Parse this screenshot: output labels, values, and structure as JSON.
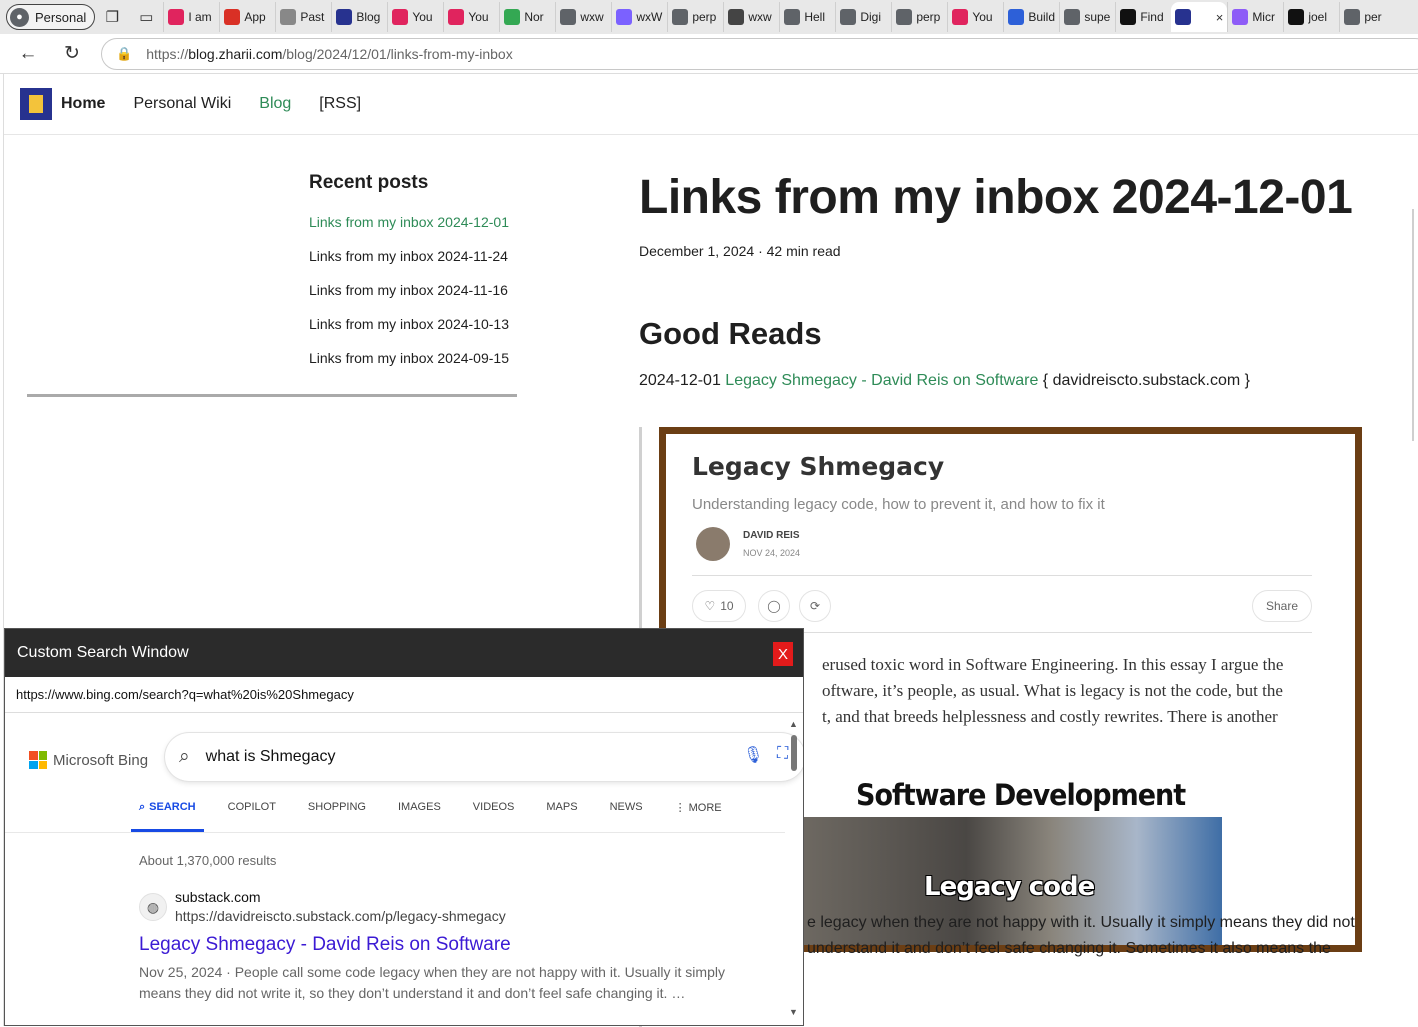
{
  "browser": {
    "profile_label": "Personal",
    "tabs": [
      {
        "label": "I am",
        "icon": "youtube-icon",
        "color": "#e0245e"
      },
      {
        "label": "App",
        "icon": "gmail-icon",
        "color": "#d93025"
      },
      {
        "label": "Past",
        "icon": "document-icon",
        "color": "#888888"
      },
      {
        "label": "Blog",
        "icon": "site-icon",
        "color": "#27328f"
      },
      {
        "label": "You",
        "icon": "youtube-icon",
        "color": "#e0245e"
      },
      {
        "label": "You",
        "icon": "youtube-icon",
        "color": "#e0245e"
      },
      {
        "label": "Nor",
        "icon": "maps-icon",
        "color": "#34a853"
      },
      {
        "label": "wxw",
        "icon": "search-icon",
        "color": "#5f6368"
      },
      {
        "label": "wxW",
        "icon": "image-icon",
        "color": "#7b61ff"
      },
      {
        "label": "perp",
        "icon": "search-icon",
        "color": "#5f6368"
      },
      {
        "label": "wxw",
        "icon": "grid-icon",
        "color": "#444444"
      },
      {
        "label": "Hell",
        "icon": "globe-icon",
        "color": "#5f6368"
      },
      {
        "label": "Digi",
        "icon": "globe-icon",
        "color": "#5f6368"
      },
      {
        "label": "perp",
        "icon": "search-icon",
        "color": "#5f6368"
      },
      {
        "label": "You",
        "icon": "youtube-icon",
        "color": "#e0245e"
      },
      {
        "label": "Build",
        "icon": "circle-icon",
        "color": "#2d60d8"
      },
      {
        "label": "supe",
        "icon": "search-icon",
        "color": "#5f6368"
      },
      {
        "label": "Find",
        "icon": "triangle-icon",
        "color": "#111111"
      },
      {
        "label": "",
        "icon": "site-icon",
        "color": "#27328f",
        "active": true
      },
      {
        "label": "Micr",
        "icon": "copilot-icon",
        "color": "#8e5cf7"
      },
      {
        "label": "joel",
        "icon": "github-icon",
        "color": "#111111"
      },
      {
        "label": "per",
        "icon": "search-icon",
        "color": "#5f6368"
      }
    ],
    "url_prefix": "https://",
    "url_host": "blog.zharii.com",
    "url_path": "/blog/2024/12/01/links-from-my-inbox"
  },
  "site_nav": {
    "home": "Home",
    "wiki": "Personal Wiki",
    "blog": "Blog",
    "rss": "[RSS]"
  },
  "sidebar": {
    "heading": "Recent posts",
    "posts": [
      "Links from my inbox 2024-12-01",
      "Links from my inbox 2024-11-24",
      "Links from my inbox 2024-11-16",
      "Links from my inbox 2024-10-13",
      "Links from my inbox 2024-09-15"
    ]
  },
  "article": {
    "title": "Links from my inbox 2024-12-01",
    "meta": "December 1, 2024 · 42 min read",
    "section": "Good Reads",
    "entry_date": "2024-12-01",
    "entry_link": "Legacy Shmegacy - David Reis on Software",
    "entry_source": "{ davidreiscto.substack.com }"
  },
  "screenshot": {
    "title": "Legacy Shmegacy",
    "subtitle": "Understanding legacy code, how to prevent it, and how to fix it",
    "author": "DAVID REIS",
    "date": "NOV 24, 2024",
    "likes": "10",
    "share": "Share",
    "body_lines": [
      "erused toxic word in Software Engineering. In this essay I argue the",
      "oftware, it’s people, as usual. What is legacy is not the code, but the",
      "t, and that breeds helplessness and costly rewrites. There is another"
    ],
    "meme_top": "Software Development",
    "meme_bottom": "Legacy code"
  },
  "article_below": {
    "line1": "e legacy when they are not happy with it. Usually it simply means they did not",
    "line2": "understand it and don’t feel safe changing it. Sometimes it also means the"
  },
  "search_window": {
    "title": "Custom Search Window",
    "close_label": "X",
    "url": "https://www.bing.com/search?q=what%20is%20Shmegacy",
    "brand": "Microsoft Bing",
    "query": "what is Shmegacy",
    "tabs": [
      "SEARCH",
      "COPILOT",
      "SHOPPING",
      "IMAGES",
      "VIDEOS",
      "MAPS",
      "NEWS",
      "⋮ MORE"
    ],
    "result_count": "About 1,370,000 results",
    "result": {
      "site": "substack.com",
      "url": "https://davidreiscto.substack.com/p/legacy-shmegacy",
      "title": "Legacy Shmegacy - David Reis on Software",
      "snippet": "Nov 25, 2024 · People call some code legacy when they are not happy with it. Usually it simply means they did not write it, so they don’t understand it and don’t feel safe changing it. …"
    }
  }
}
